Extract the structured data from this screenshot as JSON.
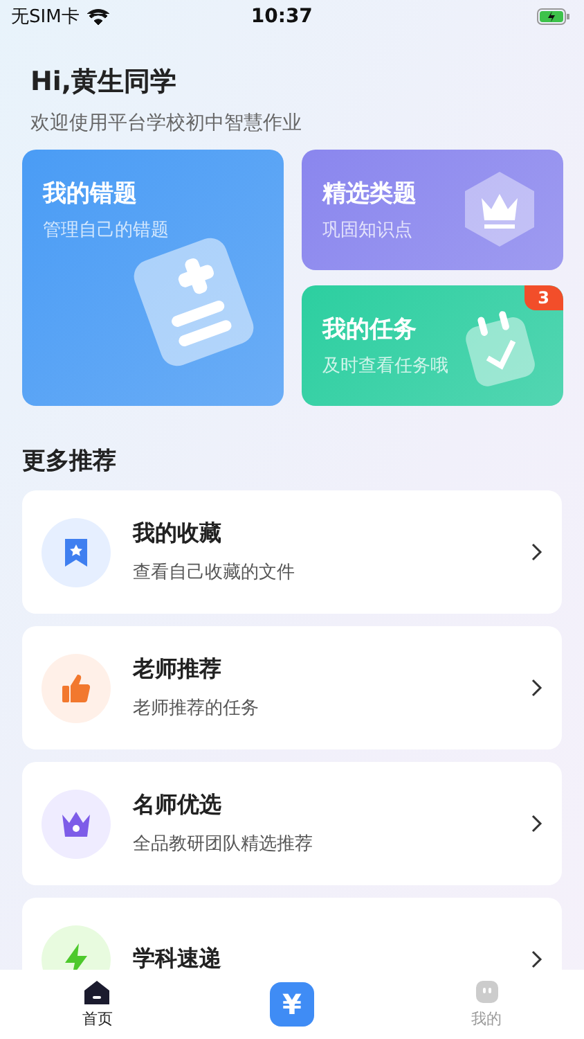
{
  "status_bar": {
    "carrier": "无SIM卡",
    "time": "10:37"
  },
  "greeting": {
    "title": "Hi,黄生同学",
    "subtitle": "欢迎使用平台学校初中智慧作业"
  },
  "feature_cards": [
    {
      "kind": "mistakes",
      "title": "我的错题",
      "subtitle": "管理自己的错题",
      "color": "#4a9cf5"
    },
    {
      "kind": "selected",
      "title": "精选类题",
      "subtitle": "巩固知识点",
      "color": "#8a86ee"
    },
    {
      "kind": "tasks",
      "title": "我的任务",
      "subtitle": "及时查看任务哦",
      "color": "#2ccfa0",
      "badge": "3"
    }
  ],
  "section_title": "更多推荐",
  "recommendations": [
    {
      "kind": "bookmark",
      "title": "我的收藏",
      "subtitle": "查看自己收藏的文件",
      "color": "#e6efff"
    },
    {
      "kind": "thumb",
      "title": "老师推荐",
      "subtitle": "老师推荐的任务",
      "color": "#fff0e8"
    },
    {
      "kind": "crown",
      "title": "名师优选",
      "subtitle": "全品教研团队精选推荐",
      "color": "#efecff"
    },
    {
      "kind": "bolt",
      "title": "学科速递",
      "color": "#e8fbdf"
    }
  ],
  "tab_bar": [
    {
      "kind": "home",
      "label": "首页",
      "selected": true
    },
    {
      "kind": "profile",
      "label": "我的",
      "selected": false
    }
  ],
  "pay_button": {
    "label": "¥"
  }
}
